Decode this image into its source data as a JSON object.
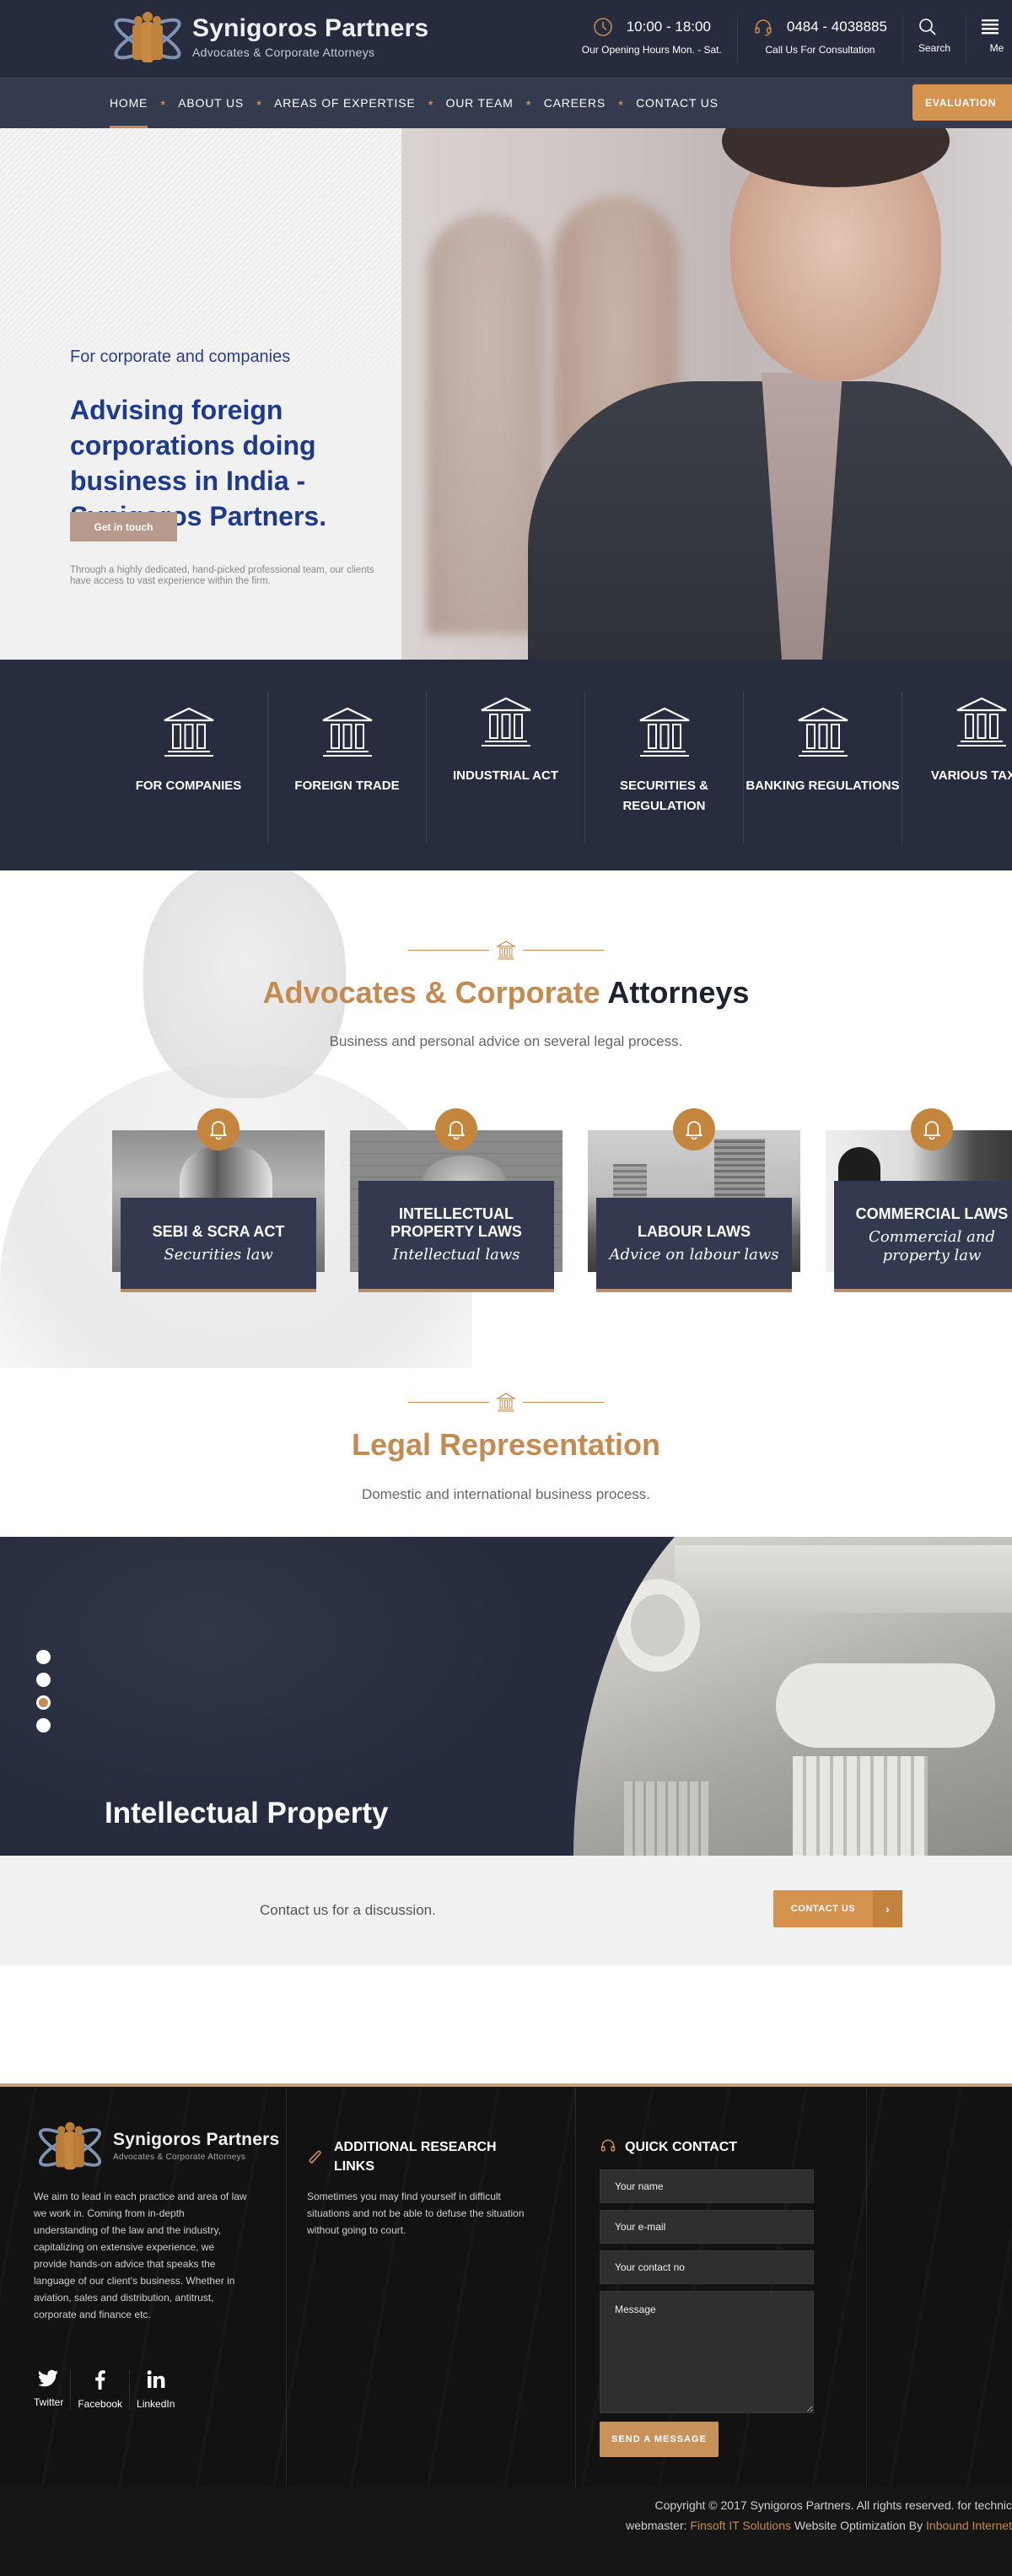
{
  "brand": {
    "name": "Synigoros Partners",
    "tagline": "Advocates & Corporate Attorneys",
    "accent_color": "#c48a4f",
    "dark_color": "#262c3d",
    "hero_title_color": "#1e3a8c"
  },
  "header": {
    "hours": {
      "icon": "clock-icon",
      "value": "10:00 - 18:00",
      "label": "Our Opening Hours Mon. - Sat."
    },
    "phone": {
      "icon": "headset-icon",
      "value": "0484 - 4038885",
      "label": "Call Us For Consultation"
    },
    "search_label": "Search",
    "menu_label": "Me"
  },
  "nav": {
    "items": [
      {
        "label": "HOME",
        "active": true
      },
      {
        "label": "ABOUT US"
      },
      {
        "label": "AREAS OF EXPERTISE"
      },
      {
        "label": "OUR TEAM"
      },
      {
        "label": "CAREERS"
      },
      {
        "label": "CONTACT US"
      }
    ],
    "evaluation_label": "EVALUATION"
  },
  "hero": {
    "eyebrow": "For corporate and companies",
    "title": "Advising foreign corporations doing business in India - Synigoros Partners.",
    "cta_label": "Get in touch",
    "description": "Through a highly dedicated, hand-picked professional team, our clients have access to vast experience within the firm."
  },
  "practice_areas": [
    {
      "label": "FOR COMPANIES",
      "icon": "courthouse-icon"
    },
    {
      "label": "FOREIGN TRADE",
      "icon": "courthouse-icon"
    },
    {
      "label": "INDUSTRIAL ACT",
      "icon": "courthouse-icon"
    },
    {
      "label": "SECURITIES & REGULATION",
      "icon": "courthouse-icon"
    },
    {
      "label": "BANKING REGULATIONS",
      "icon": "courthouse-icon"
    },
    {
      "label": "VARIOUS TAXES",
      "icon": "courthouse-icon"
    }
  ],
  "advocates": {
    "title_accent": "Advocates & Corporate",
    "title_dark": "Attorneys",
    "subtitle": "Business and personal advice on several legal process.",
    "cards": [
      {
        "title": "SEBI & SCRA ACT",
        "subtitle": "Securities law",
        "icon": "bell-icon"
      },
      {
        "title": "INTELLECTUAL PROPERTY LAWS",
        "subtitle": "Intellectual laws",
        "icon": "bell-icon"
      },
      {
        "title": "LABOUR LAWS",
        "subtitle": "Advice on labour laws",
        "icon": "bell-icon"
      },
      {
        "title": "COMMERCIAL LAWS",
        "subtitle": "Commercial and property law",
        "icon": "bell-icon"
      }
    ]
  },
  "legal": {
    "title": "Legal Representation",
    "subtitle": "Domestic and international business process."
  },
  "slider": {
    "title": "Intellectual Property",
    "slide_count": 4,
    "active_index": 2
  },
  "cta": {
    "text": "Contact us for a discussion.",
    "button_label": "CONTACT US",
    "button_arrow": "›"
  },
  "footer": {
    "about": "We aim to lead in each practice and area of law we work in. Coming from in-depth understanding of the law and the industry, capitalizing on extensive experience, we provide hands-on advice that speaks the language of our client's business. Whether in aviation, sales and distribution, antitrust, corporate and finance etc.",
    "social": [
      {
        "label": "Twitter",
        "icon": "twitter-icon"
      },
      {
        "label": "Facebook",
        "icon": "facebook-icon"
      },
      {
        "label": "LinkedIn",
        "icon": "linkedin-icon"
      }
    ],
    "research": {
      "title": "ADDITIONAL RESEARCH LINKS",
      "text": "Sometimes you may find yourself in difficult situations and not be able to defuse the situation without going to court."
    },
    "contact": {
      "title": "QUICK CONTACT",
      "name_placeholder": "Your name",
      "email_placeholder": "Your e-mail",
      "phone_placeholder": "Your contact no",
      "message_placeholder": "Message",
      "submit_label": "SEND A MESSAGE"
    }
  },
  "copyright": {
    "line1": "Copyright © 2017 Synigoros Partners. All rights reserved. for technic",
    "line2_prefix": "webmaster: ",
    "webmaster_link": "Finsoft IT Solutions",
    "line2_mid": " Website Optimization By ",
    "seo_link": "Inbound Internet"
  }
}
